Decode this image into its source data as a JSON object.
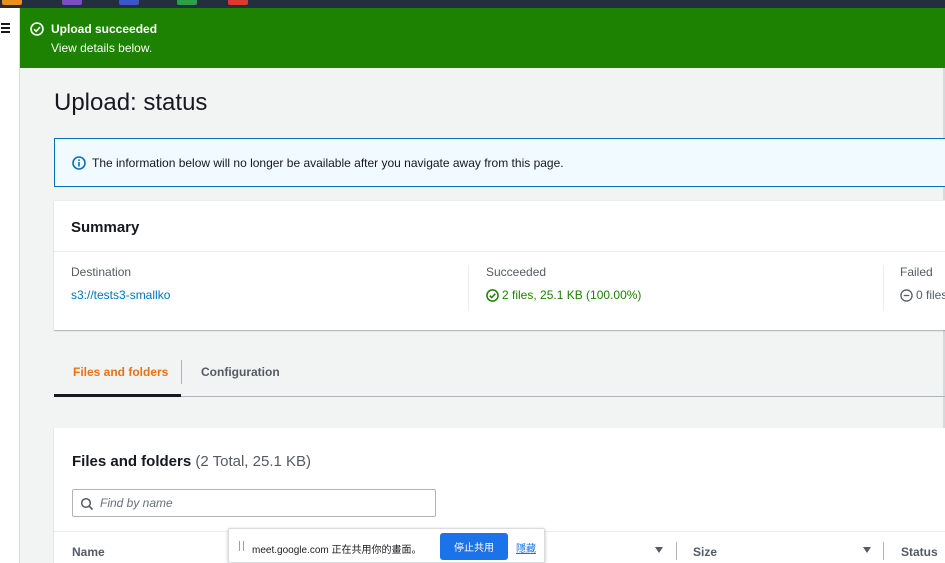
{
  "colors": {
    "success_green": "#1d8102",
    "link_blue": "#0073bb",
    "tab_orange": "#ec7211",
    "info_bg": "#f1faff",
    "share_blue": "#1a73e8"
  },
  "nav": {
    "menu_icon": "hamburger-icon"
  },
  "flash": {
    "icon": "check-circle-icon",
    "title": "Upload succeeded",
    "subtitle": "View details below."
  },
  "page": {
    "title": "Upload: status"
  },
  "info_alert": {
    "icon": "info-circle-icon",
    "text": "The information below will no longer be available after you navigate away from this page."
  },
  "summary": {
    "heading": "Summary",
    "destination": {
      "label": "Destination",
      "value": "s3://tests3-smallko"
    },
    "succeeded": {
      "label": "Succeeded",
      "value": "2 files, 25.1 KB (100.00%)",
      "icon": "check-circle-icon"
    },
    "failed": {
      "label": "Failed",
      "value": "0 files",
      "icon": "minus-circle-icon"
    }
  },
  "tabs": [
    {
      "label": "Files and folders",
      "active": true
    },
    {
      "label": "Configuration",
      "active": false
    }
  ],
  "files": {
    "heading": "Files and folders",
    "count": "(2 Total, 25.1 KB)",
    "search_placeholder": "Find by name",
    "search_icon": "search-icon",
    "columns": [
      "Name",
      "Size",
      "Status"
    ]
  },
  "screen_share": {
    "message": "meet.google.com 正在共用你的畫面。",
    "stop_label": "停止共用",
    "hide_label": "隱藏"
  }
}
